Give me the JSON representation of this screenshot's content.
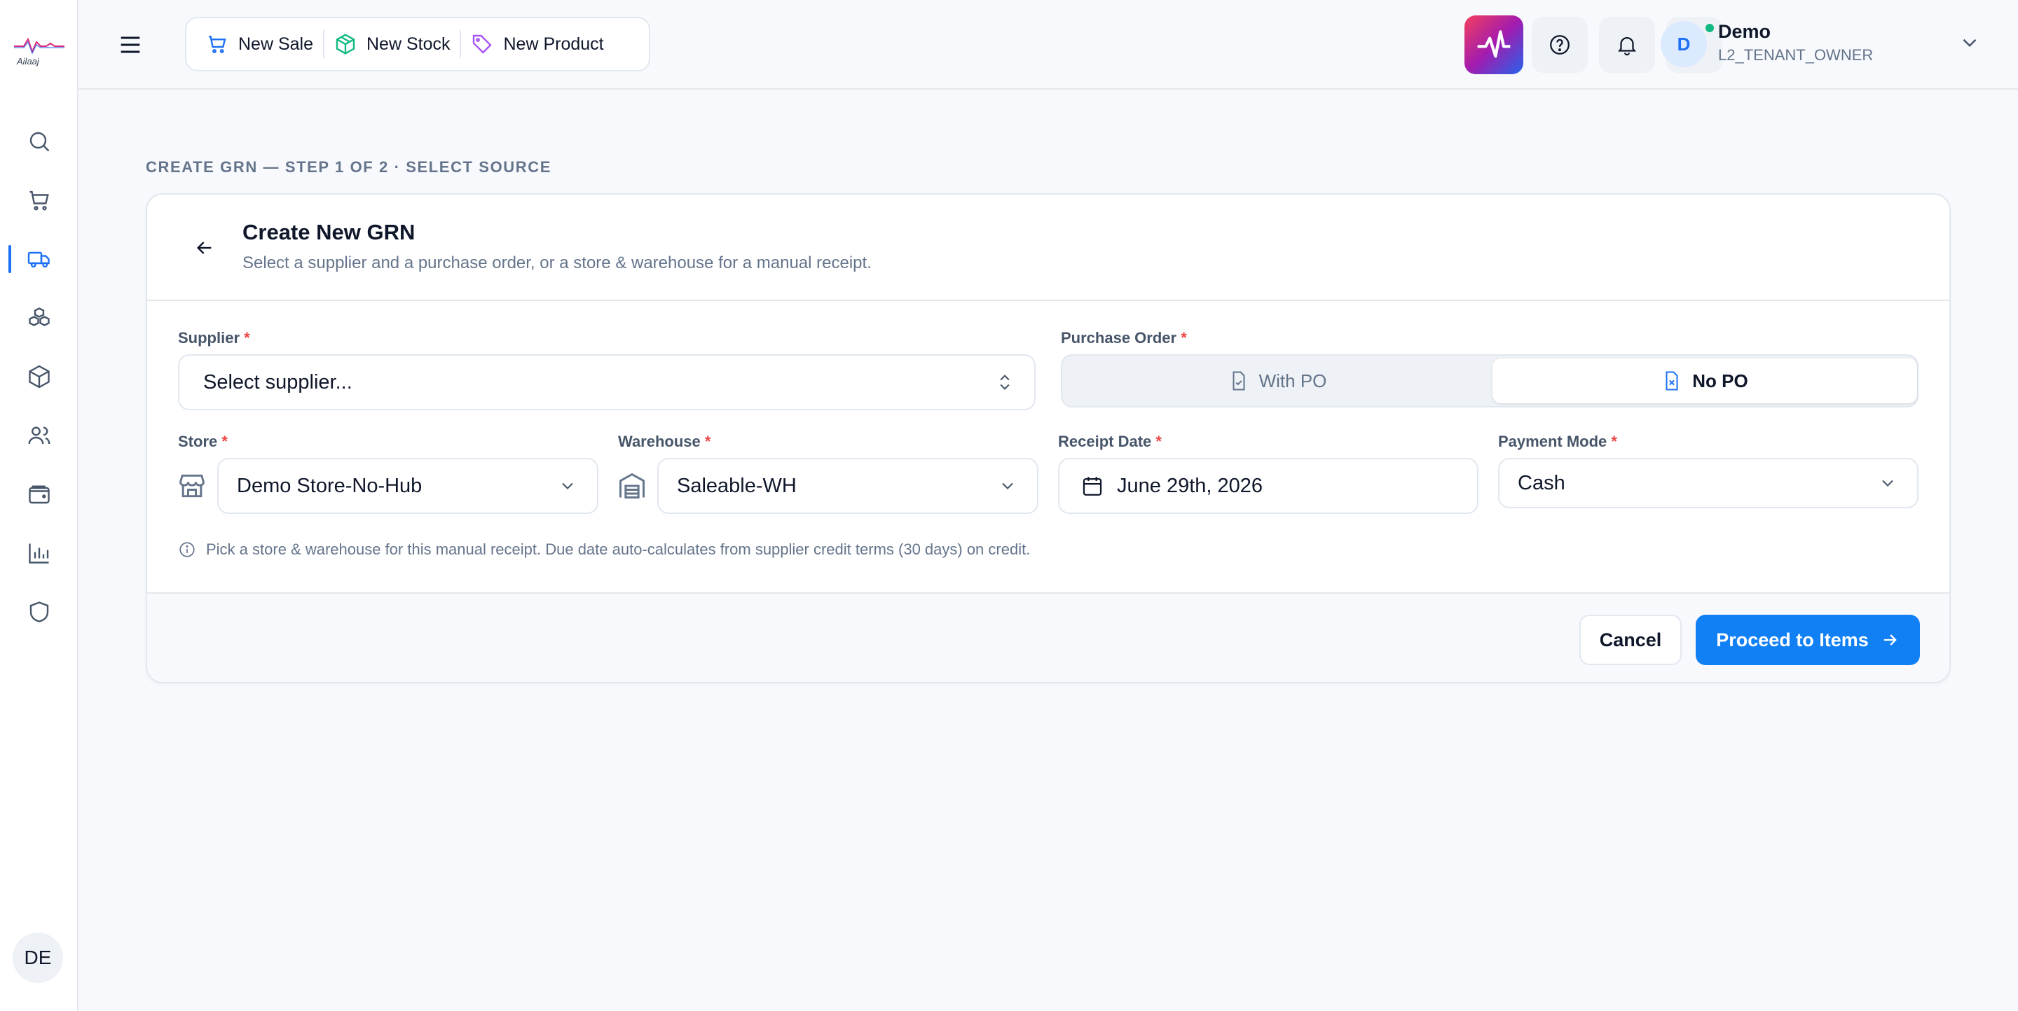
{
  "app": {
    "logo_text": "Ailaaj"
  },
  "sidebar": {
    "items": [
      {
        "name": "search",
        "icon": "search-icon"
      },
      {
        "name": "sales",
        "icon": "cart-icon"
      },
      {
        "name": "purchases",
        "icon": "truck-icon",
        "active": true
      },
      {
        "name": "inventory",
        "icon": "boxes-icon"
      },
      {
        "name": "products",
        "icon": "package-icon"
      },
      {
        "name": "customers",
        "icon": "users-icon"
      },
      {
        "name": "finance",
        "icon": "wallet-icon"
      },
      {
        "name": "reports",
        "icon": "bar-chart-icon"
      },
      {
        "name": "security",
        "icon": "shield-icon"
      }
    ],
    "user_initials": "DE"
  },
  "topbar": {
    "quick_actions": [
      {
        "label": "New Sale",
        "icon": "cart-icon",
        "color": "#1d70f5"
      },
      {
        "label": "New Stock",
        "icon": "box-icon",
        "color": "#10b981"
      },
      {
        "label": "New Product",
        "icon": "tag-icon",
        "color": "#a855f7"
      }
    ],
    "user": {
      "initial": "D",
      "name": "Demo",
      "role": "L2_TENANT_OWNER"
    }
  },
  "page": {
    "step_label": "CREATE GRN — STEP 1 OF 2 · SELECT SOURCE",
    "title": "Create New GRN",
    "subtitle": "Select a supplier and a purchase order, or a store & warehouse for a manual receipt."
  },
  "form": {
    "supplier": {
      "label": "Supplier",
      "required": "*",
      "placeholder": "Select supplier..."
    },
    "purchase_order": {
      "label": "Purchase Order",
      "required": "*",
      "options": [
        "With PO",
        "No PO"
      ],
      "selected": "No PO"
    },
    "store": {
      "label": "Store",
      "required": "*",
      "value": "Demo Store-No-Hub"
    },
    "warehouse": {
      "label": "Warehouse",
      "required": "*",
      "value": "Saleable-WH"
    },
    "receipt_date": {
      "label": "Receipt Date",
      "required": "*",
      "value": "June 29th, 2026"
    },
    "payment_mode": {
      "label": "Payment Mode",
      "required": "*",
      "value": "Cash"
    },
    "info": "Pick a store & warehouse for this manual receipt. Due date auto-calculates from supplier credit terms (30 days) on credit."
  },
  "actions": {
    "cancel": "Cancel",
    "proceed": "Proceed to Items"
  },
  "colors": {
    "primary": "#1180f5",
    "required": "#ef4444",
    "online": "#10b981"
  }
}
